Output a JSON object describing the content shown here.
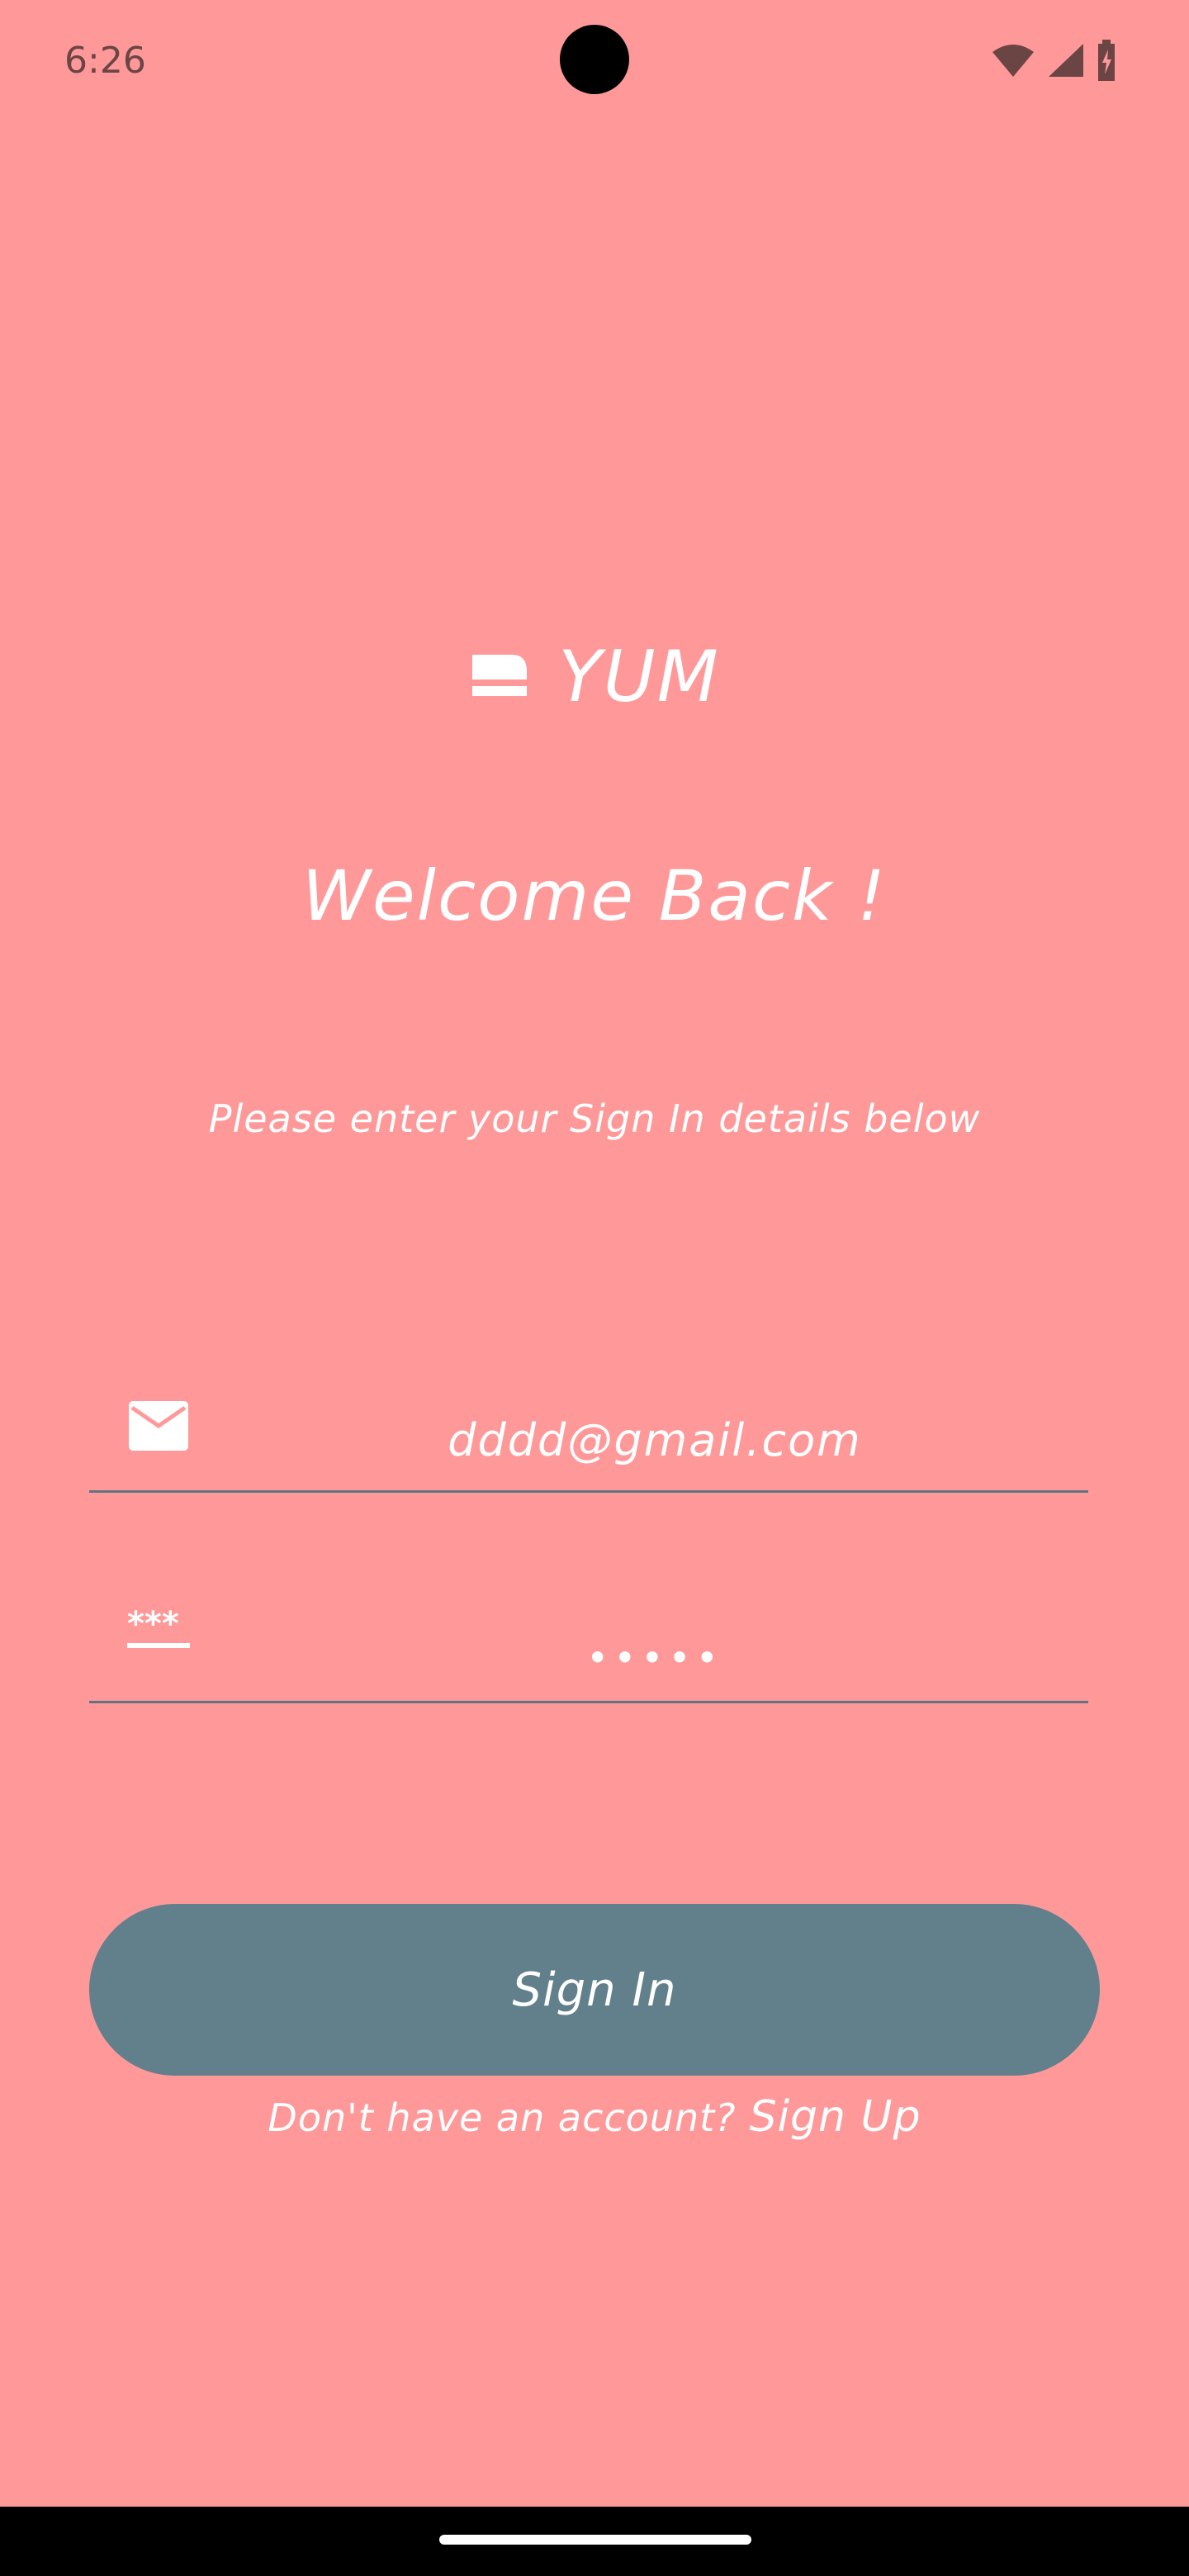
{
  "status_bar": {
    "time": "6:26",
    "icons": [
      "wifi-icon",
      "cellular-signal-icon",
      "battery-charging-icon"
    ]
  },
  "brand": {
    "logo_icon": "chef-hat-icon",
    "title": "YUM"
  },
  "welcome": {
    "heading": "Welcome Back !",
    "subtitle": "Please enter your Sign In details below"
  },
  "form": {
    "email": {
      "icon": "email-icon",
      "value": "dddd@gmail.com"
    },
    "password": {
      "icon": "password-icon",
      "value": "•••••"
    },
    "submit_label": "Sign In"
  },
  "signup": {
    "prompt": "Don't have an account?",
    "link": "Sign Up"
  },
  "colors": {
    "background": "#FF9999",
    "button": "#62808B",
    "text": "#FFFFFF",
    "underline": "#5F7480"
  }
}
